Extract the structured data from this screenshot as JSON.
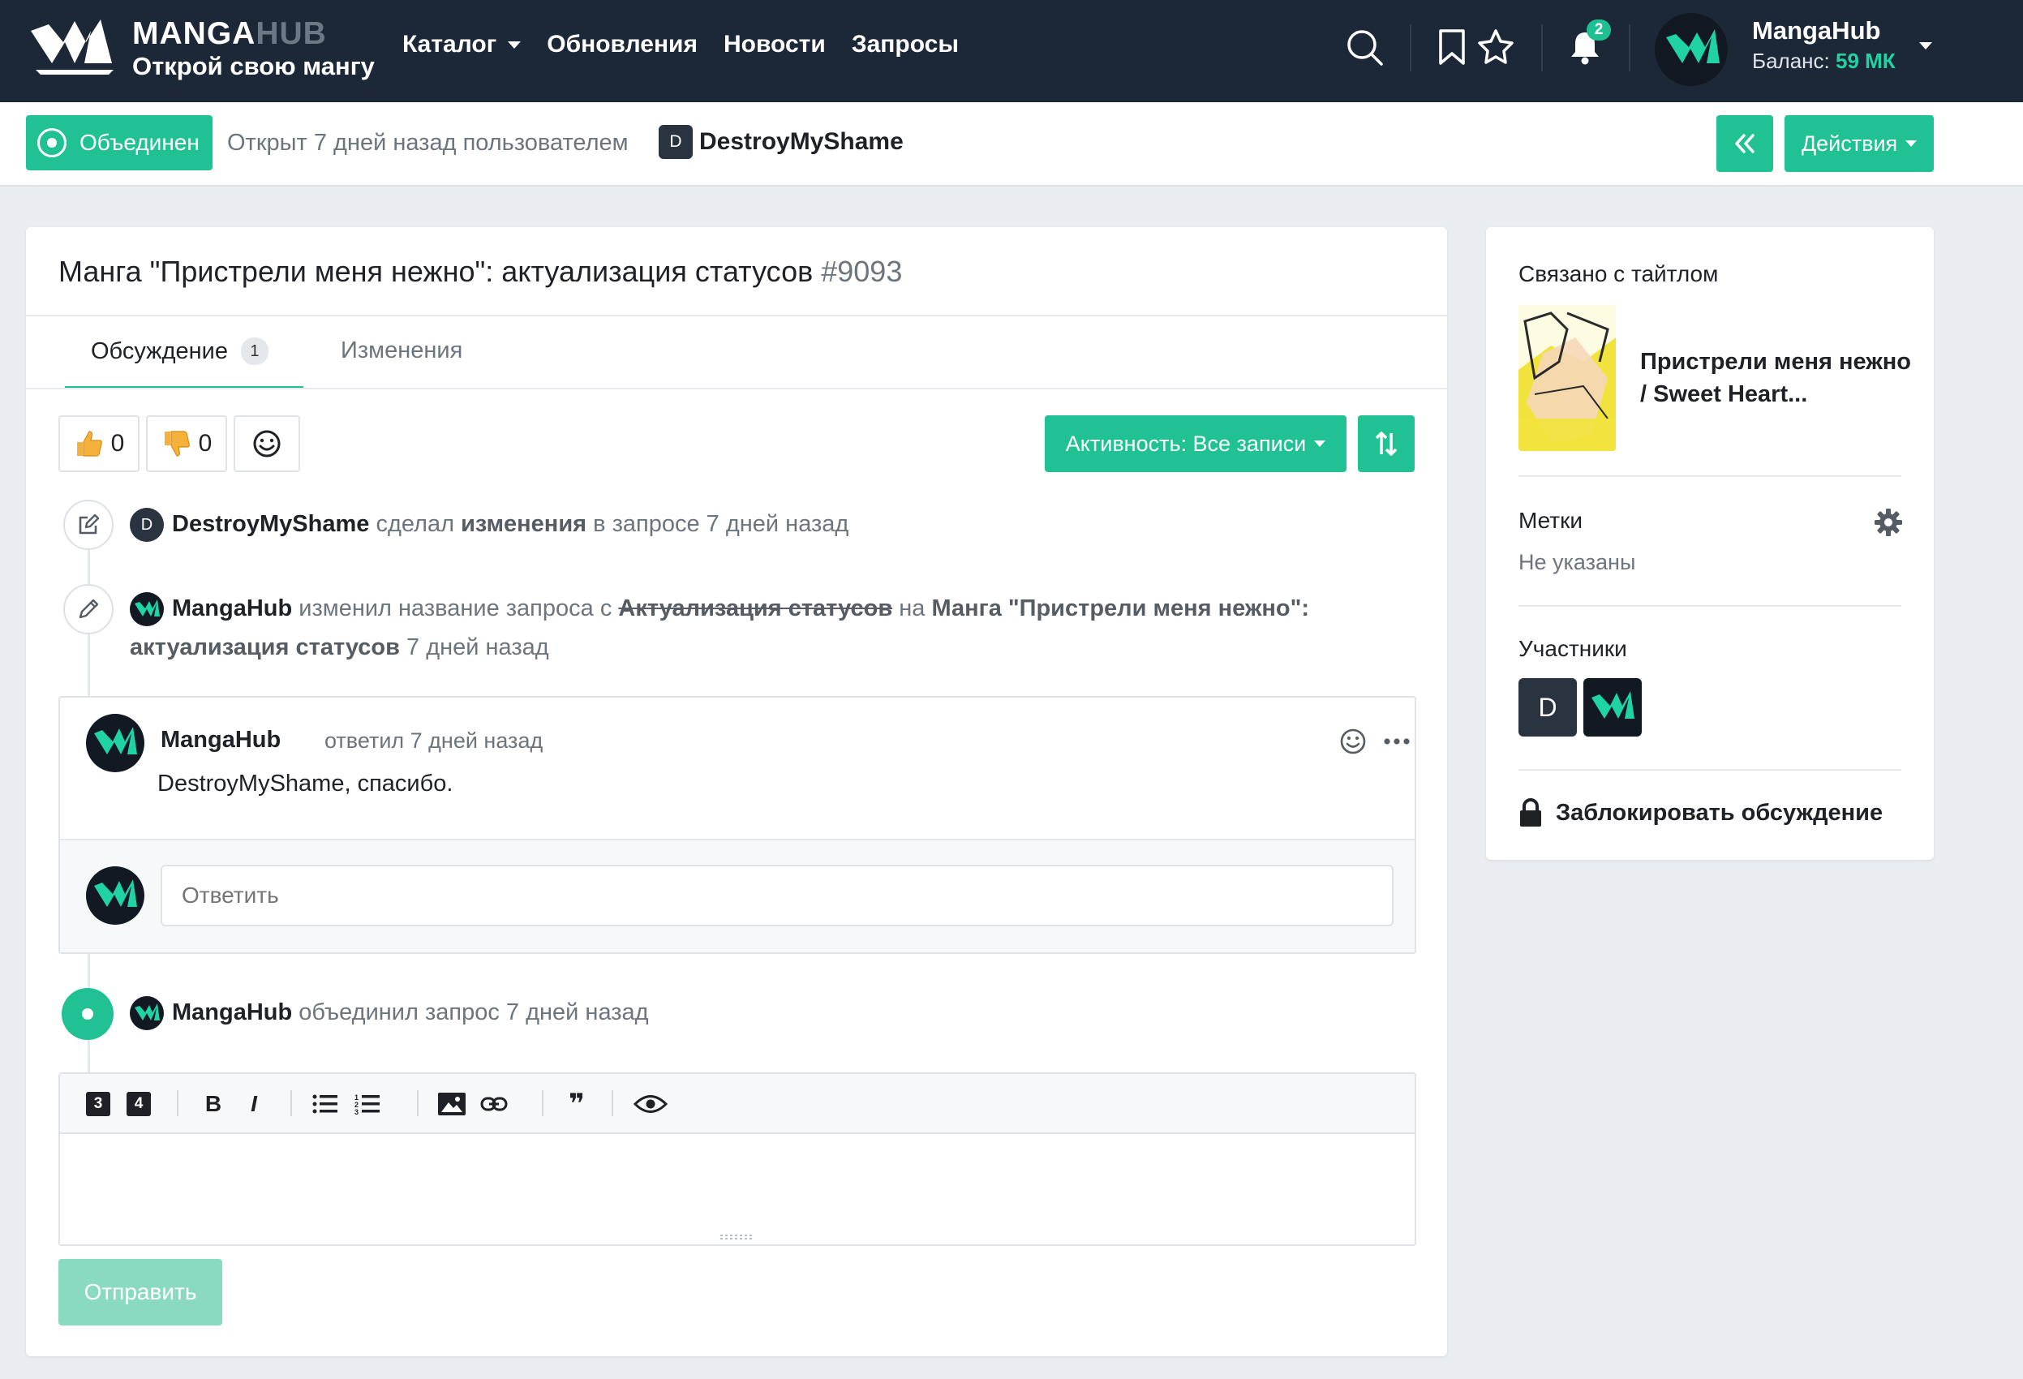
{
  "navbar": {
    "brand_main": "MANGA",
    "brand_hub": "HUB",
    "brand_tagline": "Открой свою мангу",
    "links": [
      {
        "label": "Каталог",
        "has_caret": true
      },
      {
        "label": "Обновления"
      },
      {
        "label": "Новости"
      },
      {
        "label": "Запросы"
      }
    ],
    "icons": [
      "search-icon",
      "bookmark-icon",
      "star-icon",
      "bell-icon"
    ],
    "notification_count": "2",
    "username": "MangaHub",
    "balance_label": "Баланс:",
    "balance_value": "59 МК"
  },
  "subheader": {
    "status_label": "Объединен",
    "opened_text": "Открыт 7 дней назад пользователем",
    "author_initial": "D",
    "author_name": "DestroyMyShame",
    "actions_label": "Действия"
  },
  "request": {
    "title": "Манга \"Пристрели меня нежно\": актуализация статусов",
    "number": "#9093",
    "tabs": [
      {
        "label": "Обсуждение",
        "count": "1",
        "active": true
      },
      {
        "label": "Изменения"
      }
    ],
    "reactions": {
      "like_count": "0",
      "dislike_count": "0"
    },
    "activity_filter": "Активность: Все записи"
  },
  "timeline": {
    "event1": {
      "initial": "D",
      "user": "DestroyMyShame",
      "t1": "сделал",
      "t2": "изменения",
      "t3": "в запросе 7 дней назад"
    },
    "event2": {
      "user": "MangaHub",
      "t1": "изменил название запроса с",
      "old_title": "Актуализация статусов",
      "t2": "на",
      "new_title_line1": "Манга \"Пристрели меня нежно\":",
      "new_title_line2": "актуализация статусов",
      "t3": "7 дней назад"
    },
    "comment": {
      "author": "MangaHub",
      "meta": "ответил 7 дней назад",
      "body": "DestroyMyShame, спасибо.",
      "reply_placeholder": "Ответить"
    },
    "event3": {
      "user": "MangaHub",
      "text": "объединил запрос 7 дней назад"
    }
  },
  "editor": {
    "h3": "3",
    "h4": "4",
    "bold": "B",
    "italic": "I",
    "quote": "❞",
    "submit_label": "Отправить"
  },
  "sidebar": {
    "linked_heading": "Связано с тайтлом",
    "linked_title": "Пристрели меня нежно / Sweet Heart...",
    "tags_heading": "Метки",
    "tags_value": "Не указаны",
    "participants_heading": "Участники",
    "participant_initial": "D",
    "lock_label": "Заблокировать обсуждение"
  },
  "colors": {
    "accent": "#20c193",
    "navbar": "#1c2837",
    "balance": "#1fd3a5"
  }
}
